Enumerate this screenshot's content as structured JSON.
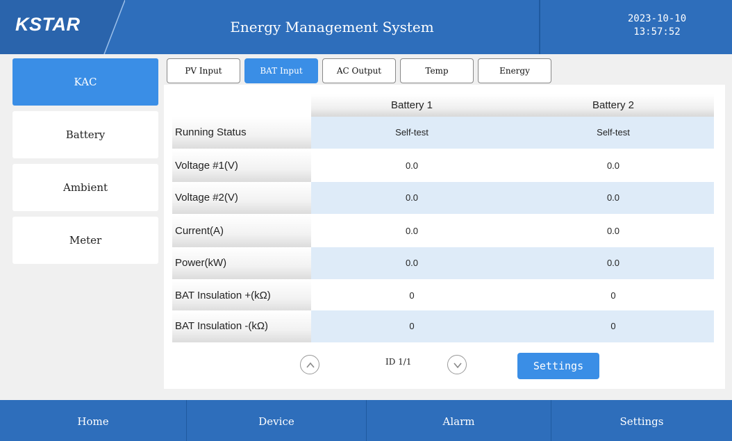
{
  "header": {
    "logo": "KSTAR",
    "title": "Energy Management System",
    "date": "2023-10-10",
    "time": "13:57:52"
  },
  "sidebar": {
    "items": [
      {
        "label": "KAC",
        "active": true
      },
      {
        "label": "Battery",
        "active": false
      },
      {
        "label": "Ambient",
        "active": false
      },
      {
        "label": "Meter",
        "active": false
      }
    ]
  },
  "tabs": [
    {
      "label": "PV Input",
      "active": false
    },
    {
      "label": "BAT Input",
      "active": true
    },
    {
      "label": "AC Output",
      "active": false
    },
    {
      "label": "Temp",
      "active": false
    },
    {
      "label": "Energy",
      "active": false
    }
  ],
  "table": {
    "columns": [
      "Battery 1",
      "Battery 2"
    ],
    "rows": [
      {
        "label": "Running Status",
        "values": [
          "Self-test",
          "Self-test"
        ]
      },
      {
        "label": "Voltage #1(V)",
        "values": [
          "0.0",
          "0.0"
        ]
      },
      {
        "label": "Voltage #2(V)",
        "values": [
          "0.0",
          "0.0"
        ]
      },
      {
        "label": "Current(A)",
        "values": [
          "0.0",
          "0.0"
        ]
      },
      {
        "label": "Power(kW)",
        "values": [
          "0.0",
          "0.0"
        ]
      },
      {
        "label": "BAT Insulation +(kΩ)",
        "values": [
          "0",
          "0"
        ]
      },
      {
        "label": "BAT Insulation  -(kΩ)",
        "values": [
          "0",
          "0"
        ]
      }
    ]
  },
  "pager": {
    "page_text": "ID 1/1",
    "up_icon": "chevron-up-circle-icon",
    "down_icon": "chevron-down-circle-icon"
  },
  "settings_button": "Settings",
  "footer": {
    "items": [
      "Home",
      "Device",
      "Alarm",
      "Settings"
    ]
  },
  "colors": {
    "header_blue": "#2e6ebb",
    "accent_blue": "#3a8ee6",
    "row_highlight": "#deebf8"
  }
}
